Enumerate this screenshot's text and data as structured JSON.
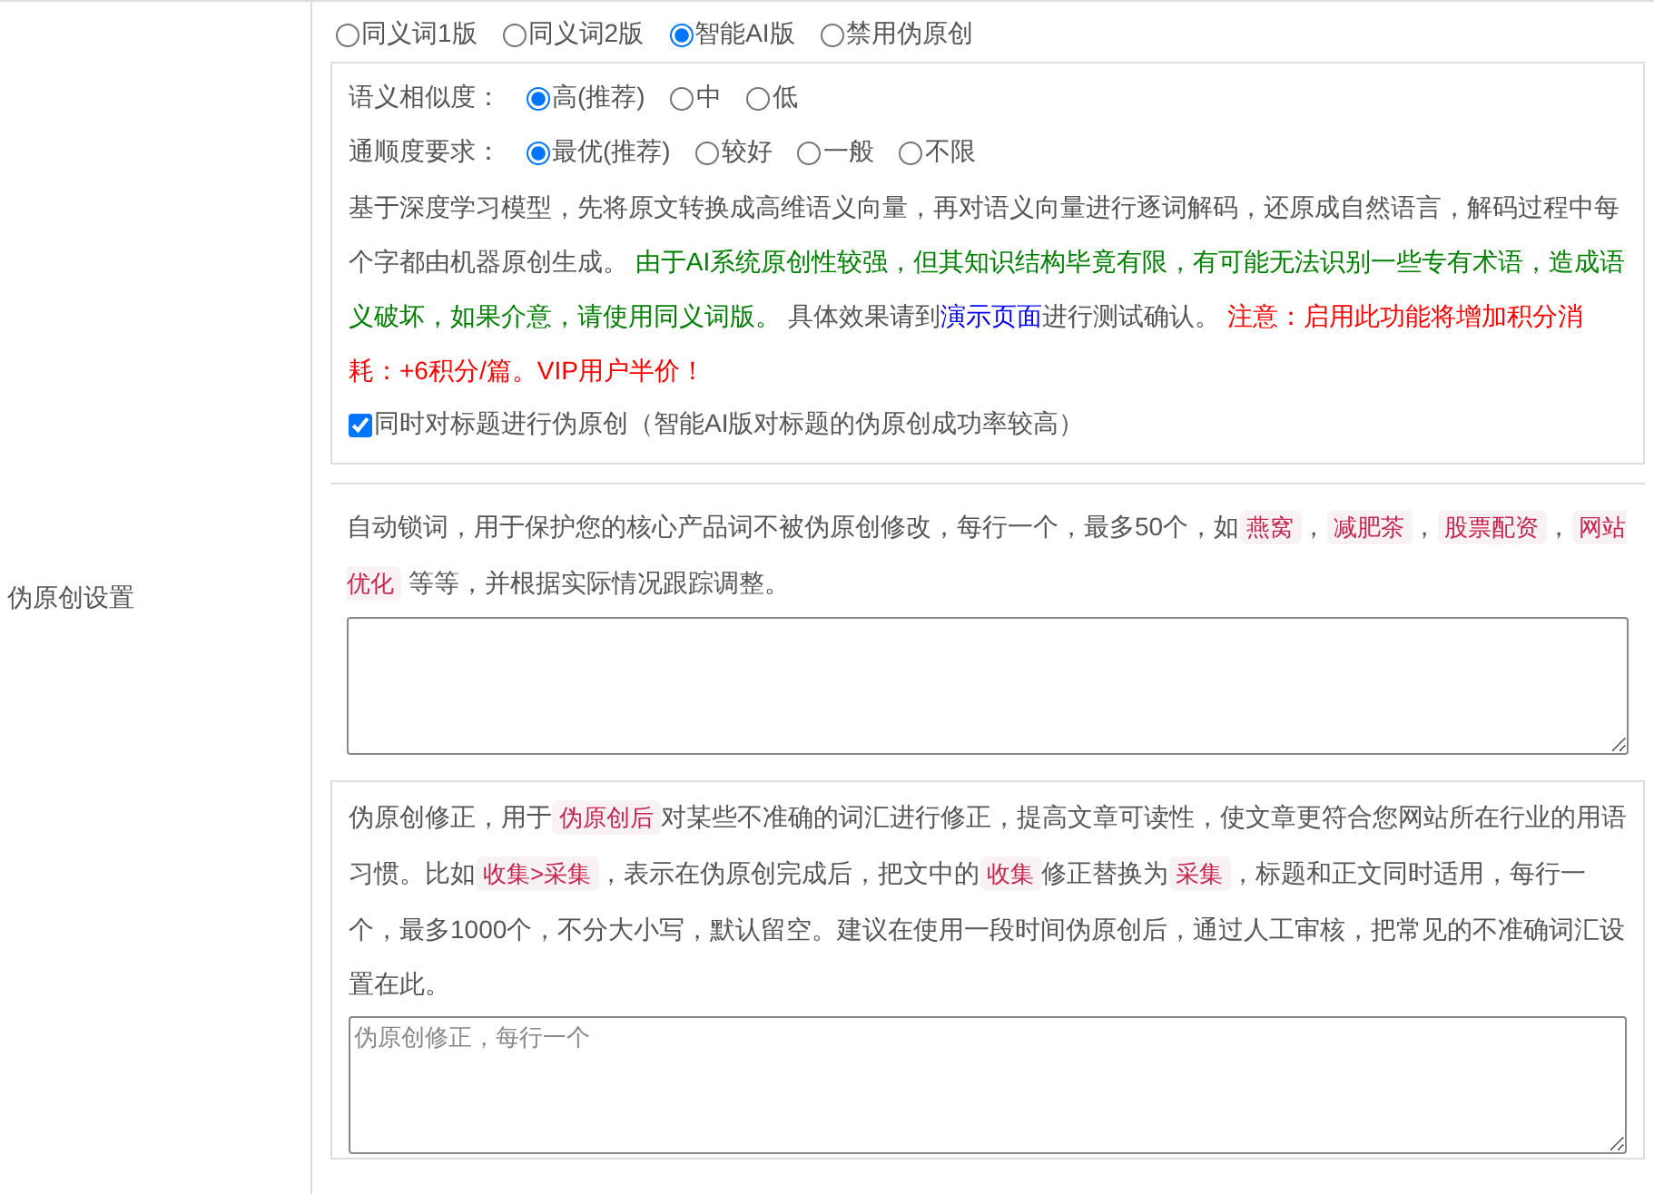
{
  "sidebar_label": "伪原创设置",
  "mode_options": [
    {
      "label": "同义词1版",
      "selected": false
    },
    {
      "label": "同义词2版",
      "selected": false
    },
    {
      "label": "智能AI版",
      "selected": true
    },
    {
      "label": "禁用伪原创",
      "selected": false
    }
  ],
  "settings_box": {
    "similarity": {
      "label": "语义相似度：",
      "options": [
        {
          "label": "高(推荐)",
          "selected": true
        },
        {
          "label": "中",
          "selected": false
        },
        {
          "label": "低",
          "selected": false
        }
      ]
    },
    "fluency": {
      "label": "通顺度要求：",
      "options": [
        {
          "label": "最优(推荐)",
          "selected": true
        },
        {
          "label": "较好",
          "selected": false
        },
        {
          "label": "一般",
          "selected": false
        },
        {
          "label": "不限",
          "selected": false
        }
      ]
    },
    "description": [
      {
        "kind": "text",
        "text": "基于深度学习模型，先将原文转换成高维语义向量，再对语义向量进行逐词解码，还原成自然语言，解码过程中每个字都由机器原创生成。 "
      },
      {
        "kind": "green",
        "text": "由于AI系统原创性较强，但其知识结构毕竟有限，有可能无法识别一些专有术语，造成语义破坏，如果介意，请使用同义词版。"
      },
      {
        "kind": "text",
        "text": " 具体效果请到"
      },
      {
        "kind": "link",
        "text": "演示页面"
      },
      {
        "kind": "text",
        "text": "进行测试确认。 "
      },
      {
        "kind": "red",
        "text": "注意：启用此功能将增加积分消耗：+6积分/篇。VIP用户半价！"
      }
    ],
    "title_option": {
      "label": "同时对标题进行伪原创（智能AI版对标题的伪原创成功率较高）",
      "checked": true
    }
  },
  "lock_words": {
    "description": [
      {
        "kind": "text",
        "text": "自动锁词，用于保护您的核心产品词不被伪原创修改，每行一个，最多50个，如"
      },
      {
        "kind": "code",
        "text": "燕窝"
      },
      {
        "kind": "text",
        "text": "，"
      },
      {
        "kind": "code",
        "text": "减肥茶"
      },
      {
        "kind": "text",
        "text": "，"
      },
      {
        "kind": "code",
        "text": "股票配资"
      },
      {
        "kind": "text",
        "text": "，"
      },
      {
        "kind": "code",
        "text": "网站优化"
      },
      {
        "kind": "text",
        "text": " 等等，并根据实际情况跟踪调整。"
      }
    ]
  },
  "correction": {
    "description": [
      {
        "kind": "text",
        "text": "伪原创修正，用于"
      },
      {
        "kind": "code",
        "text": "伪原创后"
      },
      {
        "kind": "text",
        "text": "对某些不准确的词汇进行修正，提高文章可读性，使文章更符合您网站所在行业的用语习惯。比如"
      },
      {
        "kind": "code",
        "text": "收集>采集"
      },
      {
        "kind": "text",
        "text": "，表示在伪原创完成后，把文中的"
      },
      {
        "kind": "code",
        "text": "收集"
      },
      {
        "kind": "text",
        "text": "修正替换为"
      },
      {
        "kind": "code",
        "text": "采集"
      },
      {
        "kind": "text",
        "text": "，标题和正文同时适用，每行一个，最多1000个，不分大小写，默认留空。建议在使用一段时间伪原创后，通过人工审核，把常见的不准确词汇设置在此。"
      }
    ],
    "textarea": {
      "placeholder": "伪原创修正，每行一个"
    }
  }
}
